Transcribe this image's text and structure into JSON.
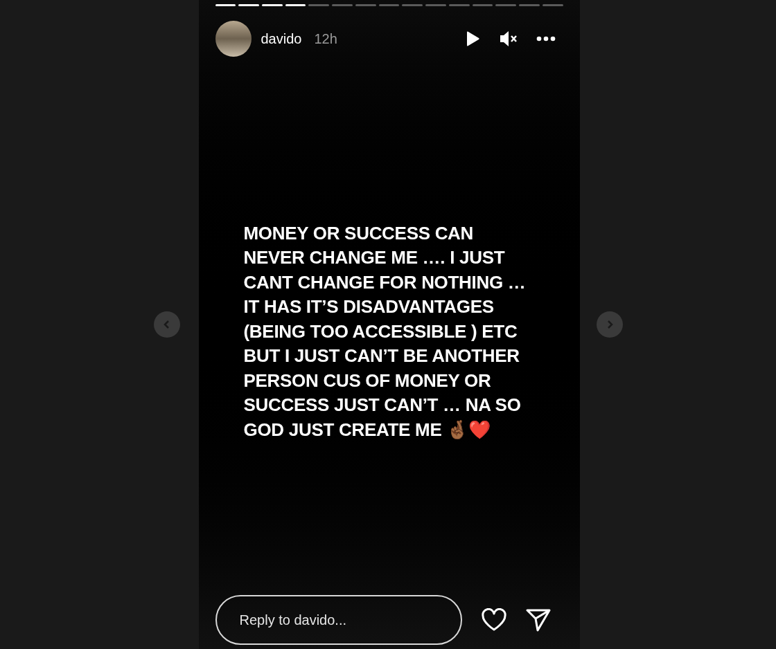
{
  "progress": [
    {
      "level": 1
    },
    {
      "level": 1
    },
    {
      "level": 1
    },
    {
      "level": 1
    },
    {
      "level": 0
    },
    {
      "level": 0
    },
    {
      "level": 0
    },
    {
      "level": 0
    },
    {
      "level": 0
    },
    {
      "level": 0
    },
    {
      "level": 0
    },
    {
      "level": 0
    },
    {
      "level": 0
    },
    {
      "level": 0
    },
    {
      "level": 0
    }
  ],
  "header": {
    "username": "davido",
    "time": "12h",
    "muted": true
  },
  "story_text": "MONEY OR SUCCESS CAN\nNEVER CHANGE ME …. I JUST\nCANT CHANGE FOR NOTHING …\nIT HAS IT’S DISADVANTAGES\n(BEING TOO ACCESSIBLE ) ETC\nBUT I JUST CAN’T BE ANOTHER\nPERSON CUS OF MONEY OR\nSUCCESS JUST CAN’T … NA SO\nGOD JUST CREATE ME 🤞🏾❤️",
  "reply": {
    "placeholder": "Reply to davido..."
  }
}
